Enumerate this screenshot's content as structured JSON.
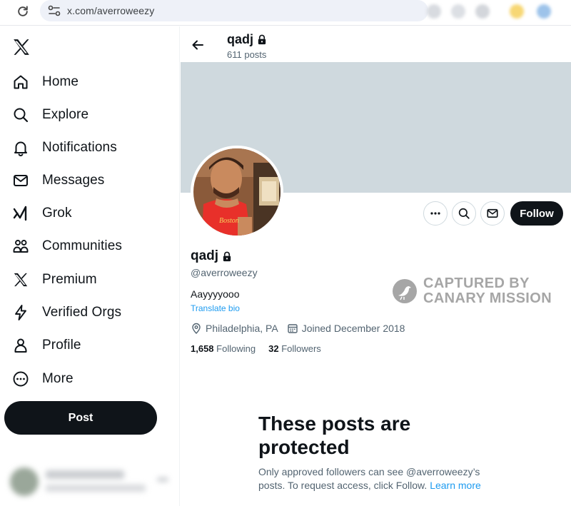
{
  "browser": {
    "url": "x.com/averroweezy"
  },
  "sidebar": {
    "items": [
      {
        "label": "Home",
        "icon": "home-icon"
      },
      {
        "label": "Explore",
        "icon": "search-icon"
      },
      {
        "label": "Notifications",
        "icon": "bell-icon"
      },
      {
        "label": "Messages",
        "icon": "envelope-icon"
      },
      {
        "label": "Grok",
        "icon": "grok-icon"
      },
      {
        "label": "Communities",
        "icon": "people-icon"
      },
      {
        "label": "Premium",
        "icon": "x-logo-icon"
      },
      {
        "label": "Verified Orgs",
        "icon": "lightning-icon"
      },
      {
        "label": "Profile",
        "icon": "person-icon"
      },
      {
        "label": "More",
        "icon": "more-circle-icon"
      }
    ],
    "post_label": "Post"
  },
  "header": {
    "name": "qadj",
    "post_count": "611 posts"
  },
  "profile": {
    "name": "qadj",
    "handle": "@averroweezy",
    "bio": "Aayyyyooo",
    "translate": "Translate bio",
    "location": "Philadelphia, PA",
    "joined": "Joined December 2018",
    "following_count": "1,658",
    "following_label": "Following",
    "followers_count": "32",
    "followers_label": "Followers",
    "follow_label": "Follow"
  },
  "watermark": {
    "line1": "CAPTURED BY",
    "line2": "CANARY MISSION"
  },
  "protected": {
    "title": "These posts are protected",
    "text": "Only approved followers can see @averroweezy’s posts. To request access, click Follow.",
    "link": "Learn more"
  },
  "colors": {
    "accent": "#1d9bf0",
    "text": "#0f1419",
    "muted": "#536471",
    "banner": "#cfd9de",
    "button_dark": "#0f1419"
  }
}
